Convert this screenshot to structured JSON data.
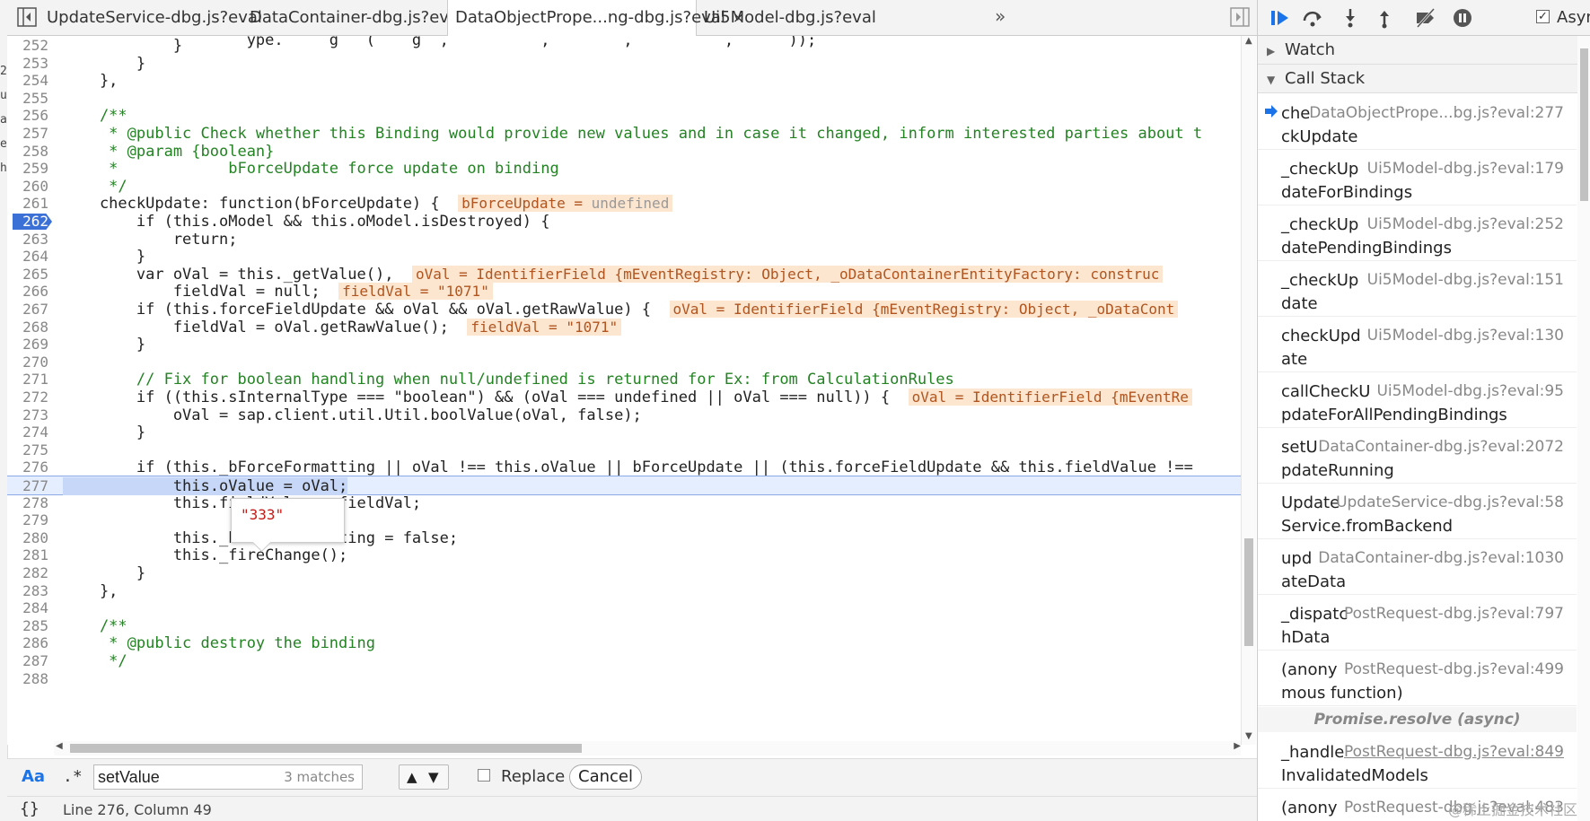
{
  "tabs": [
    {
      "label": "UpdateService-dbg.js?eval",
      "active": false
    },
    {
      "label": "DataContainer-dbg.js?eval",
      "active": false
    },
    {
      "label": "DataObjectPrope...ng-dbg.js?eval",
      "active": true,
      "close": "×"
    },
    {
      "label": "Ui5Model-dbg.js?eval",
      "active": false
    }
  ],
  "tabs_more": "»",
  "editor": {
    "breakpoint_line": "262",
    "execution_line": "277",
    "lines": [
      {
        "n": "252",
        "code": "            }"
      },
      {
        "n": "253",
        "code": "        }"
      },
      {
        "n": "254",
        "code": "    },"
      },
      {
        "n": "255",
        "code": ""
      },
      {
        "n": "256",
        "code": "    /**"
      },
      {
        "n": "257",
        "code": "     * @public Check whether this Binding would provide new values and in case it changed, inform interested parties about t"
      },
      {
        "n": "258",
        "code": "     * @param {boolean}"
      },
      {
        "n": "259",
        "code": "     *            bForceUpdate force update on binding"
      },
      {
        "n": "260",
        "code": "     */"
      },
      {
        "n": "261",
        "code": "    checkUpdate: function(bForceUpdate) {"
      },
      {
        "n": "262",
        "code": "        if (this.oModel && this.oModel.isDestroyed) {"
      },
      {
        "n": "263",
        "code": "            return;"
      },
      {
        "n": "264",
        "code": "        }"
      },
      {
        "n": "265",
        "code": "        var oVal = this._getValue(),"
      },
      {
        "n": "266",
        "code": "            fieldVal = null;"
      },
      {
        "n": "267",
        "code": "        if (this.forceFieldUpdate && oVal && oVal.getRawValue) {"
      },
      {
        "n": "268",
        "code": "            fieldVal = oVal.getRawValue();"
      },
      {
        "n": "269",
        "code": "        }"
      },
      {
        "n": "270",
        "code": ""
      },
      {
        "n": "271",
        "code": "        // Fix for boolean handling when null/undefined is returned for Ex: from CalculationRules"
      },
      {
        "n": "272",
        "code": "        if ((this.sInternalType === \"boolean\") && (oVal === undefined || oVal === null)) {"
      },
      {
        "n": "273",
        "code": "            oVal = sap.client.util.Util.boolValue(oVal, false);"
      },
      {
        "n": "274",
        "code": "        }"
      },
      {
        "n": "275",
        "code": ""
      },
      {
        "n": "276",
        "code": "        if (this._bForceFormatting || oVal !== this.oValue || bForceUpdate || (this.forceFieldUpdate && this.fieldValue !== "
      },
      {
        "n": "277",
        "code": "            this.oValue = oVal;"
      },
      {
        "n": "278",
        "code": "            this.fieldValue = fieldVal;"
      },
      {
        "n": "279",
        "code": ""
      },
      {
        "n": "280",
        "code": "            this._bForceFormatting = false;"
      },
      {
        "n": "281",
        "code": "            this._fireChange();"
      },
      {
        "n": "282",
        "code": "        }"
      },
      {
        "n": "283",
        "code": "    },"
      },
      {
        "n": "284",
        "code": ""
      },
      {
        "n": "285",
        "code": "    /**"
      },
      {
        "n": "286",
        "code": "     * @public destroy the binding"
      },
      {
        "n": "287",
        "code": "     */"
      },
      {
        "n": "288",
        "code": ""
      }
    ],
    "top_partial": "                    ype.     g   (    g  ,          ,        ,          ,      ));",
    "inline_values": {
      "l261": {
        "name": "bForceUpdate",
        "eq": " = ",
        "val": "undefined"
      },
      "l265": "oVal = IdentifierField {mEventRegistry: Object, _oDataContainerEntityFactory: construc",
      "l266": "fieldVal = \"1071\"",
      "l267": "oVal = IdentifierField {mEventRegistry: Object, _oDataCont",
      "l268": "fieldVal = \"1071\"",
      "l272": "oVal = IdentifierField {mEventRe"
    },
    "tooltip_value": "\"333\""
  },
  "search": {
    "case_label": "Aa",
    "regex_label": ".*",
    "query": "setValue",
    "matches": "3 matches",
    "prev": "▲",
    "next": "▼",
    "replace_label": "Replace",
    "cancel_label": "Cancel"
  },
  "status": {
    "braces": "{}",
    "position": "Line 276, Column 49"
  },
  "left_strip_fragments": [
    "2",
    "ub",
    "a",
    "ec",
    "h"
  ],
  "sidebar": {
    "async_label": "Async",
    "watch_label": "Watch",
    "callstack_label": "Call Stack",
    "frames": [
      {
        "fn1": "che",
        "fn2": "ckUpdate",
        "loc": "DataObjectPrope...bg.js?eval:277",
        "current": true
      },
      {
        "fn1": "_checkUp",
        "fn2": "dateForBindings",
        "loc": "Ui5Model-dbg.js?eval:179"
      },
      {
        "fn1": "_checkUp",
        "fn2": "datePendingBindings",
        "loc": "Ui5Model-dbg.js?eval:252"
      },
      {
        "fn1": "_checkUp",
        "fn2": "date",
        "loc": "Ui5Model-dbg.js?eval:151"
      },
      {
        "fn1": "checkUpd",
        "fn2": "ate",
        "loc": "Ui5Model-dbg.js?eval:130"
      },
      {
        "fn1": "callCheckU",
        "fn2": "pdateForAllPendingBindings",
        "loc": "Ui5Model-dbg.js?eval:95"
      },
      {
        "fn1": "setU",
        "fn2": "pdateRunning",
        "loc": "DataContainer-dbg.js?eval:2072"
      },
      {
        "fn1": "Update",
        "fn2": "Service.fromBackend",
        "loc": "UpdateService-dbg.js?eval:58"
      },
      {
        "fn1": "upd",
        "fn2": "ateData",
        "loc": "DataContainer-dbg.js?eval:1030"
      },
      {
        "fn1": "_dispatc",
        "fn2": "hData",
        "loc": "PostRequest-dbg.js?eval:797"
      },
      {
        "fn1": "(anony",
        "fn2": "mous function)",
        "loc": "PostRequest-dbg.js?eval:499"
      }
    ],
    "async_separator": "Promise.resolve (async)",
    "frames_after": [
      {
        "fn1": "_handle",
        "fn2": "InvalidatedModels",
        "loc": "PostRequest-dbg.js?eval:849",
        "link": true
      },
      {
        "fn1": "(anony",
        "fn2": "",
        "loc": "PostRequest-dbg.js?eval:483"
      }
    ]
  },
  "watermark": "@稀土掘金技术社区",
  "colors": {
    "breakpoint": "#3b70d6",
    "exec_line": "#e4eeff",
    "keyword": "#a0188f",
    "string": "#c41a16",
    "comment": "#238323",
    "inline_value_bg": "#fde6d0"
  }
}
